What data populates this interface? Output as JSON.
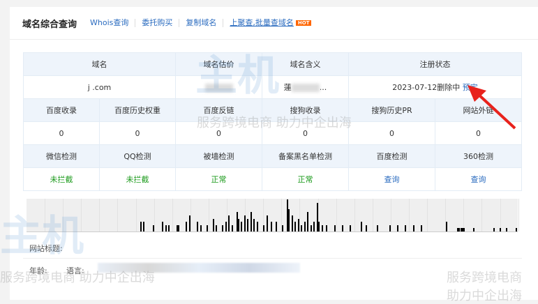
{
  "header": {
    "title": "域名综合查询",
    "links": [
      "Whois查询",
      "委托购买",
      "复制域名",
      "上聚查,批量查域名"
    ],
    "hot_badge": "HOT"
  },
  "table": {
    "row1_headers": [
      "域名",
      "域名估价",
      "域名含义",
      "注册状态"
    ],
    "row1_values": {
      "domain": "j    .com",
      "meaning_prefix": "蓮",
      "meaning_suffix": "...",
      "status": "2023-07-12删除中",
      "reserve_link": "预定"
    },
    "row2_headers": [
      "百度收录",
      "百度历史权重",
      "百度反链",
      "搜狗收录",
      "搜狗历史PR",
      "网站外链"
    ],
    "row2_values": [
      "0",
      "0",
      "0",
      "0",
      "0",
      "0"
    ],
    "row3_headers": [
      "微信检测",
      "QQ检测",
      "被墙检测",
      "备案黑名单检测",
      "百度检测",
      "360检测"
    ],
    "row3_values": [
      "未拦截",
      "未拦截",
      "正常",
      "正常",
      "查询",
      "查询"
    ]
  },
  "chart_data": {
    "type": "bar",
    "title": "",
    "values": [
      0,
      0,
      0,
      0,
      0,
      0,
      0,
      0,
      0,
      0,
      0,
      0,
      0,
      0,
      0,
      0,
      0,
      0,
      0,
      0,
      0,
      0,
      0,
      0,
      0,
      0,
      0,
      0,
      0,
      0,
      0,
      0,
      0,
      0,
      0,
      0,
      0,
      0,
      0,
      0,
      0,
      0,
      0,
      0,
      0,
      0,
      0,
      0,
      0,
      0,
      0,
      0,
      0,
      0,
      0,
      0,
      0,
      0,
      0,
      0,
      0,
      0,
      0,
      0,
      0,
      0,
      0,
      0,
      0,
      0,
      0,
      0,
      0,
      0,
      0,
      0,
      0,
      0,
      0,
      0,
      0,
      0,
      0,
      0,
      0,
      0,
      0,
      0,
      0,
      0,
      0,
      0,
      0,
      0,
      0,
      0,
      0,
      0,
      0,
      0,
      0,
      0,
      0,
      0,
      0,
      0,
      0,
      0,
      0,
      0,
      0,
      0,
      0,
      0,
      0,
      0,
      0,
      0,
      0,
      0,
      0,
      0,
      0,
      0,
      0,
      0,
      0,
      0,
      0,
      0,
      0,
      0,
      0,
      0,
      0,
      0,
      0,
      0,
      0,
      0,
      0,
      0,
      0,
      0,
      0,
      0,
      0,
      0,
      0,
      0,
      0,
      0,
      0,
      0,
      0,
      0,
      0,
      0,
      0,
      0,
      0,
      0,
      0,
      0,
      0,
      0,
      0,
      0,
      0,
      0,
      0,
      0,
      0,
      0,
      0,
      0,
      0,
      0,
      0,
      0,
      0,
      0,
      0,
      0,
      0,
      0,
      0,
      0,
      0,
      0,
      0,
      0,
      0,
      0,
      0,
      0,
      0,
      0,
      0,
      0,
      0,
      0,
      0,
      0,
      0,
      0,
      0,
      0,
      0,
      0,
      0,
      0,
      0,
      0,
      0,
      0,
      0,
      0,
      0,
      0,
      0,
      0,
      0,
      0,
      0,
      0,
      0,
      0,
      0,
      0,
      0,
      0,
      0,
      0,
      0,
      0,
      0,
      0,
      0,
      0,
      0,
      0,
      0,
      0,
      0,
      0,
      0,
      0,
      0,
      0,
      0,
      0,
      0,
      0,
      0,
      0,
      0,
      0,
      0,
      0,
      0,
      0,
      0,
      0,
      0,
      0,
      0,
      0,
      0,
      0,
      0,
      0,
      0,
      0,
      0,
      0,
      0,
      0,
      0,
      0,
      0,
      0,
      0,
      0,
      0,
      0,
      0,
      0,
      0,
      0,
      0,
      0,
      0,
      0,
      0,
      0,
      0,
      0,
      0,
      0,
      0,
      0,
      0,
      0,
      0,
      0,
      0,
      0,
      0,
      0,
      0,
      0,
      0,
      0,
      0,
      0,
      0,
      0,
      0,
      0,
      0,
      0,
      0,
      0,
      0,
      0,
      0,
      0,
      0,
      0,
      0,
      0,
      0,
      0,
      0,
      0,
      0,
      0,
      0,
      0,
      0,
      0,
      0,
      0,
      0,
      0,
      0,
      0,
      0,
      0,
      0,
      0,
      0,
      0,
      0,
      0,
      0,
      0,
      0,
      0,
      0,
      0,
      0,
      0,
      0,
      0,
      0,
      0,
      0,
      0,
      0,
      0,
      0,
      0,
      0,
      0,
      0,
      0,
      0,
      0,
      0,
      0,
      0,
      0,
      0,
      0,
      0,
      0,
      0,
      0,
      0,
      0,
      0,
      0,
      0,
      0,
      0,
      0,
      0,
      0,
      0,
      0,
      0,
      0,
      0,
      0,
      0,
      0,
      0,
      0,
      0,
      0,
      0,
      0,
      0,
      0,
      0,
      0,
      0,
      0,
      0,
      0,
      0,
      0,
      0,
      0,
      0,
      0,
      0,
      0,
      0,
      0,
      0,
      0,
      0,
      0,
      0,
      0,
      0,
      0,
      0,
      0,
      0,
      0,
      0,
      0,
      0,
      0,
      0,
      0,
      0,
      0,
      0,
      0,
      0,
      0,
      0,
      0,
      0,
      0,
      0,
      0,
      0,
      0,
      0,
      0,
      0,
      0,
      0,
      0,
      0,
      0,
      0,
      0,
      0,
      0,
      0,
      0,
      0,
      0,
      0,
      0,
      0,
      0,
      0,
      0,
      0,
      0,
      0,
      0,
      0,
      0,
      0,
      0,
      0,
      0,
      0,
      0,
      0,
      0,
      0,
      0,
      0,
      0,
      0,
      0,
      0,
      0,
      0,
      0,
      0,
      0,
      0,
      0,
      0,
      0,
      0,
      0,
      0,
      0,
      0,
      0,
      0,
      0,
      0,
      0,
      0,
      0,
      0,
      0,
      0,
      0,
      0,
      0,
      0,
      0,
      0,
      0,
      0,
      0,
      0,
      0,
      0,
      0,
      0,
      0,
      0,
      0,
      0,
      0,
      0,
      0,
      0,
      0,
      0,
      0,
      0,
      0,
      0,
      0,
      0,
      0,
      0,
      0,
      0,
      0,
      0,
      0,
      0,
      0,
      0,
      0,
      0,
      0,
      0,
      0,
      0,
      0,
      0,
      0,
      0,
      0,
      0,
      0,
      0,
      0,
      0,
      0,
      0,
      0,
      0,
      0,
      0,
      0,
      0,
      0,
      0,
      0,
      0,
      0,
      0,
      0,
      0,
      0,
      0,
      0,
      0,
      0,
      0,
      0,
      0,
      0,
      0,
      0,
      0,
      0,
      0,
      0,
      0,
      0,
      0,
      0,
      0,
      0,
      0,
      0,
      0,
      0,
      0,
      0,
      0,
      0,
      0,
      0,
      0,
      0,
      0,
      0,
      0,
      0,
      0,
      0,
      0,
      0,
      0,
      0,
      0,
      0,
      0,
      0,
      0,
      0,
      0,
      0,
      0,
      0,
      0,
      0,
      0,
      0,
      0,
      0,
      0,
      0,
      0,
      0,
      0,
      0,
      0,
      0,
      0,
      0,
      0,
      0,
      0,
      0,
      0,
      0,
      0,
      0,
      0,
      0,
      0,
      0,
      0,
      0,
      0,
      0,
      0,
      0,
      0,
      0,
      0,
      0
    ],
    "bars": [
      [
        72,
        3
      ],
      [
        74,
        3
      ],
      [
        80,
        2
      ],
      [
        86,
        3
      ],
      [
        88,
        2
      ],
      [
        90,
        2
      ],
      [
        95,
        2
      ],
      [
        96,
        2
      ],
      [
        101,
        3
      ],
      [
        103,
        5
      ],
      [
        108,
        3
      ],
      [
        110,
        2
      ],
      [
        114,
        2
      ],
      [
        118,
        4
      ],
      [
        120,
        2
      ],
      [
        124,
        2
      ],
      [
        126,
        3
      ],
      [
        128,
        5
      ],
      [
        130,
        2
      ],
      [
        133,
        6
      ],
      [
        134,
        4
      ],
      [
        136,
        3
      ],
      [
        138,
        5
      ],
      [
        140,
        4
      ],
      [
        142,
        6
      ],
      [
        144,
        4
      ],
      [
        146,
        3
      ],
      [
        150,
        2
      ],
      [
        152,
        5
      ],
      [
        155,
        3
      ],
      [
        158,
        3
      ],
      [
        162,
        2
      ],
      [
        165,
        10
      ],
      [
        166,
        7
      ],
      [
        168,
        5
      ],
      [
        170,
        3
      ],
      [
        172,
        4
      ],
      [
        174,
        2
      ],
      [
        176,
        3
      ],
      [
        178,
        6
      ],
      [
        180,
        2
      ],
      [
        182,
        3
      ],
      [
        184,
        9
      ],
      [
        185,
        3
      ],
      [
        187,
        2
      ],
      [
        190,
        2
      ],
      [
        195,
        2
      ],
      [
        200,
        2
      ],
      [
        205,
        2
      ],
      [
        212,
        3
      ],
      [
        215,
        2
      ],
      [
        222,
        2
      ],
      [
        230,
        2
      ],
      [
        235,
        2
      ],
      [
        240,
        2
      ],
      [
        245,
        2
      ],
      [
        250,
        2
      ],
      [
        266,
        3
      ],
      [
        273,
        1
      ],
      [
        274,
        1
      ],
      [
        275,
        1
      ],
      [
        276,
        1
      ],
      [
        277,
        1
      ],
      [
        283,
        1
      ],
      [
        296,
        1
      ],
      [
        300,
        1
      ],
      [
        304,
        1
      ],
      [
        310,
        1
      ]
    ],
    "bars_note": "position index, relative height (0-10)"
  },
  "info": {
    "site_title_label": "网站标题:",
    "age_label": "年龄:",
    "language_label": "语言:"
  },
  "watermark": {
    "brand": "主机百科",
    "slogan": "服务跨境电商 助力中企出海"
  },
  "colors": {
    "link": "#2a6bbf",
    "ok": "#1a9a1a",
    "hot": "#ff6600",
    "arrow": "#e8221c"
  }
}
